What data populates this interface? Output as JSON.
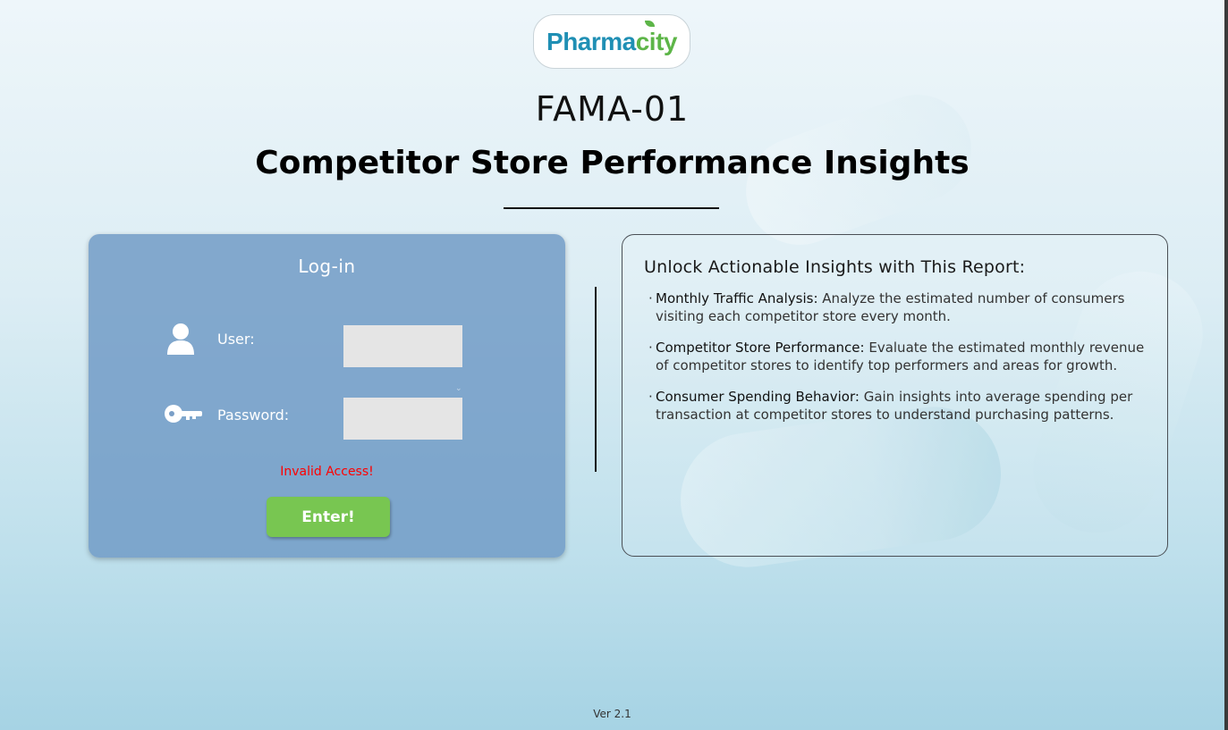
{
  "brand": {
    "logo_part1": "Pharma",
    "logo_part2": "city",
    "logo_color_primary": "#1f8fb4",
    "logo_color_accent": "#5db548"
  },
  "header": {
    "code": "FAMA-01",
    "title": "Competitor Store Performance Insights"
  },
  "login": {
    "title": "Log-in",
    "user_label": "User:",
    "user_value": "",
    "password_label": "Password:",
    "password_value": "",
    "error_message": "Invalid Access!",
    "submit_label": "Enter!",
    "icons": {
      "user": "user-icon",
      "password": "key-icon",
      "dropdown": "chevron-down-icon"
    },
    "colors": {
      "panel": "#6e98c4",
      "button": "#78c651",
      "error": "#ff0000"
    }
  },
  "info": {
    "heading": "Unlock Actionable Insights with This Report:",
    "items": [
      {
        "term": "Monthly Traffic Analysis:",
        "text": " Analyze the estimated number of consumers visiting each competitor store every month."
      },
      {
        "term": "Competitor Store Performance:",
        "text": " Evaluate the estimated monthly revenue of competitor stores to identify top performers and areas for growth."
      },
      {
        "term": "Consumer Spending Behavior:",
        "text": " Gain insights into average spending per transaction at competitor stores to understand purchasing patterns."
      }
    ]
  },
  "footer": {
    "version": "Ver 2.1"
  }
}
